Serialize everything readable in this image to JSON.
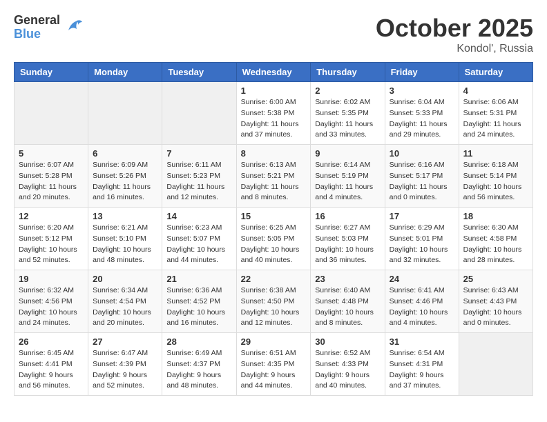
{
  "header": {
    "logo_general": "General",
    "logo_blue": "Blue",
    "month": "October 2025",
    "location": "Kondol', Russia"
  },
  "weekdays": [
    "Sunday",
    "Monday",
    "Tuesday",
    "Wednesday",
    "Thursday",
    "Friday",
    "Saturday"
  ],
  "weeks": [
    [
      {
        "day": "",
        "info": ""
      },
      {
        "day": "",
        "info": ""
      },
      {
        "day": "",
        "info": ""
      },
      {
        "day": "1",
        "info": "Sunrise: 6:00 AM\nSunset: 5:38 PM\nDaylight: 11 hours\nand 37 minutes."
      },
      {
        "day": "2",
        "info": "Sunrise: 6:02 AM\nSunset: 5:35 PM\nDaylight: 11 hours\nand 33 minutes."
      },
      {
        "day": "3",
        "info": "Sunrise: 6:04 AM\nSunset: 5:33 PM\nDaylight: 11 hours\nand 29 minutes."
      },
      {
        "day": "4",
        "info": "Sunrise: 6:06 AM\nSunset: 5:31 PM\nDaylight: 11 hours\nand 24 minutes."
      }
    ],
    [
      {
        "day": "5",
        "info": "Sunrise: 6:07 AM\nSunset: 5:28 PM\nDaylight: 11 hours\nand 20 minutes."
      },
      {
        "day": "6",
        "info": "Sunrise: 6:09 AM\nSunset: 5:26 PM\nDaylight: 11 hours\nand 16 minutes."
      },
      {
        "day": "7",
        "info": "Sunrise: 6:11 AM\nSunset: 5:23 PM\nDaylight: 11 hours\nand 12 minutes."
      },
      {
        "day": "8",
        "info": "Sunrise: 6:13 AM\nSunset: 5:21 PM\nDaylight: 11 hours\nand 8 minutes."
      },
      {
        "day": "9",
        "info": "Sunrise: 6:14 AM\nSunset: 5:19 PM\nDaylight: 11 hours\nand 4 minutes."
      },
      {
        "day": "10",
        "info": "Sunrise: 6:16 AM\nSunset: 5:17 PM\nDaylight: 11 hours\nand 0 minutes."
      },
      {
        "day": "11",
        "info": "Sunrise: 6:18 AM\nSunset: 5:14 PM\nDaylight: 10 hours\nand 56 minutes."
      }
    ],
    [
      {
        "day": "12",
        "info": "Sunrise: 6:20 AM\nSunset: 5:12 PM\nDaylight: 10 hours\nand 52 minutes."
      },
      {
        "day": "13",
        "info": "Sunrise: 6:21 AM\nSunset: 5:10 PM\nDaylight: 10 hours\nand 48 minutes."
      },
      {
        "day": "14",
        "info": "Sunrise: 6:23 AM\nSunset: 5:07 PM\nDaylight: 10 hours\nand 44 minutes."
      },
      {
        "day": "15",
        "info": "Sunrise: 6:25 AM\nSunset: 5:05 PM\nDaylight: 10 hours\nand 40 minutes."
      },
      {
        "day": "16",
        "info": "Sunrise: 6:27 AM\nSunset: 5:03 PM\nDaylight: 10 hours\nand 36 minutes."
      },
      {
        "day": "17",
        "info": "Sunrise: 6:29 AM\nSunset: 5:01 PM\nDaylight: 10 hours\nand 32 minutes."
      },
      {
        "day": "18",
        "info": "Sunrise: 6:30 AM\nSunset: 4:58 PM\nDaylight: 10 hours\nand 28 minutes."
      }
    ],
    [
      {
        "day": "19",
        "info": "Sunrise: 6:32 AM\nSunset: 4:56 PM\nDaylight: 10 hours\nand 24 minutes."
      },
      {
        "day": "20",
        "info": "Sunrise: 6:34 AM\nSunset: 4:54 PM\nDaylight: 10 hours\nand 20 minutes."
      },
      {
        "day": "21",
        "info": "Sunrise: 6:36 AM\nSunset: 4:52 PM\nDaylight: 10 hours\nand 16 minutes."
      },
      {
        "day": "22",
        "info": "Sunrise: 6:38 AM\nSunset: 4:50 PM\nDaylight: 10 hours\nand 12 minutes."
      },
      {
        "day": "23",
        "info": "Sunrise: 6:40 AM\nSunset: 4:48 PM\nDaylight: 10 hours\nand 8 minutes."
      },
      {
        "day": "24",
        "info": "Sunrise: 6:41 AM\nSunset: 4:46 PM\nDaylight: 10 hours\nand 4 minutes."
      },
      {
        "day": "25",
        "info": "Sunrise: 6:43 AM\nSunset: 4:43 PM\nDaylight: 10 hours\nand 0 minutes."
      }
    ],
    [
      {
        "day": "26",
        "info": "Sunrise: 6:45 AM\nSunset: 4:41 PM\nDaylight: 9 hours\nand 56 minutes."
      },
      {
        "day": "27",
        "info": "Sunrise: 6:47 AM\nSunset: 4:39 PM\nDaylight: 9 hours\nand 52 minutes."
      },
      {
        "day": "28",
        "info": "Sunrise: 6:49 AM\nSunset: 4:37 PM\nDaylight: 9 hours\nand 48 minutes."
      },
      {
        "day": "29",
        "info": "Sunrise: 6:51 AM\nSunset: 4:35 PM\nDaylight: 9 hours\nand 44 minutes."
      },
      {
        "day": "30",
        "info": "Sunrise: 6:52 AM\nSunset: 4:33 PM\nDaylight: 9 hours\nand 40 minutes."
      },
      {
        "day": "31",
        "info": "Sunrise: 6:54 AM\nSunset: 4:31 PM\nDaylight: 9 hours\nand 37 minutes."
      },
      {
        "day": "",
        "info": ""
      }
    ]
  ]
}
